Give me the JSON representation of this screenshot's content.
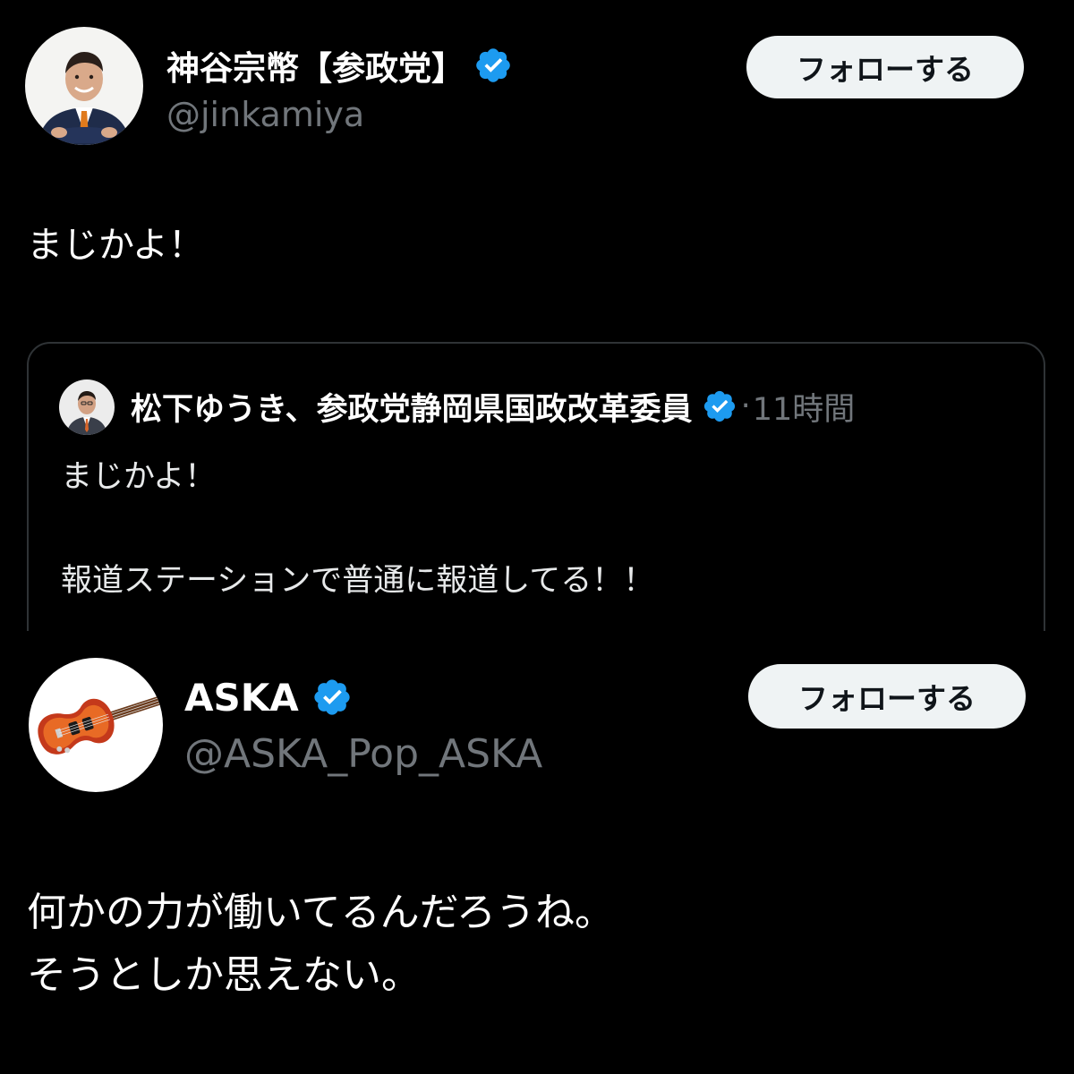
{
  "tweet1": {
    "author": {
      "display_name": "神谷宗幣【参政党】",
      "handle": "@jinkamiya",
      "verified": true,
      "avatar_icon": "avatar-photo-man-in-suit"
    },
    "follow_label": "フォローする",
    "text": "まじかよ！",
    "quoted": {
      "author": {
        "display_name": "松下ゆうき、参政党静岡県国政改革委員",
        "verified": true,
        "avatar_icon": "avatar-photo-man-in-suit"
      },
      "separator": "·",
      "time": "11時間",
      "text": "まじかよ！\n\n報道ステーションで普通に報道してる！！"
    }
  },
  "tweet2": {
    "author": {
      "display_name": "ASKA",
      "handle": "@ASKA_Pop_ASKA",
      "verified": true,
      "avatar_icon": "avatar-violin-bass-guitar"
    },
    "follow_label": "フォローする",
    "text": "何かの力が働いてるんだろうね。\nそうとしか思えない。"
  },
  "colors": {
    "background": "#000000",
    "text_primary": "#ffffff",
    "text_secondary": "#71767b",
    "verified_badge": "#1d9bf0",
    "follow_button_bg": "#eff3f4",
    "follow_button_text": "#0f1419",
    "quote_border": "#2f3336"
  }
}
